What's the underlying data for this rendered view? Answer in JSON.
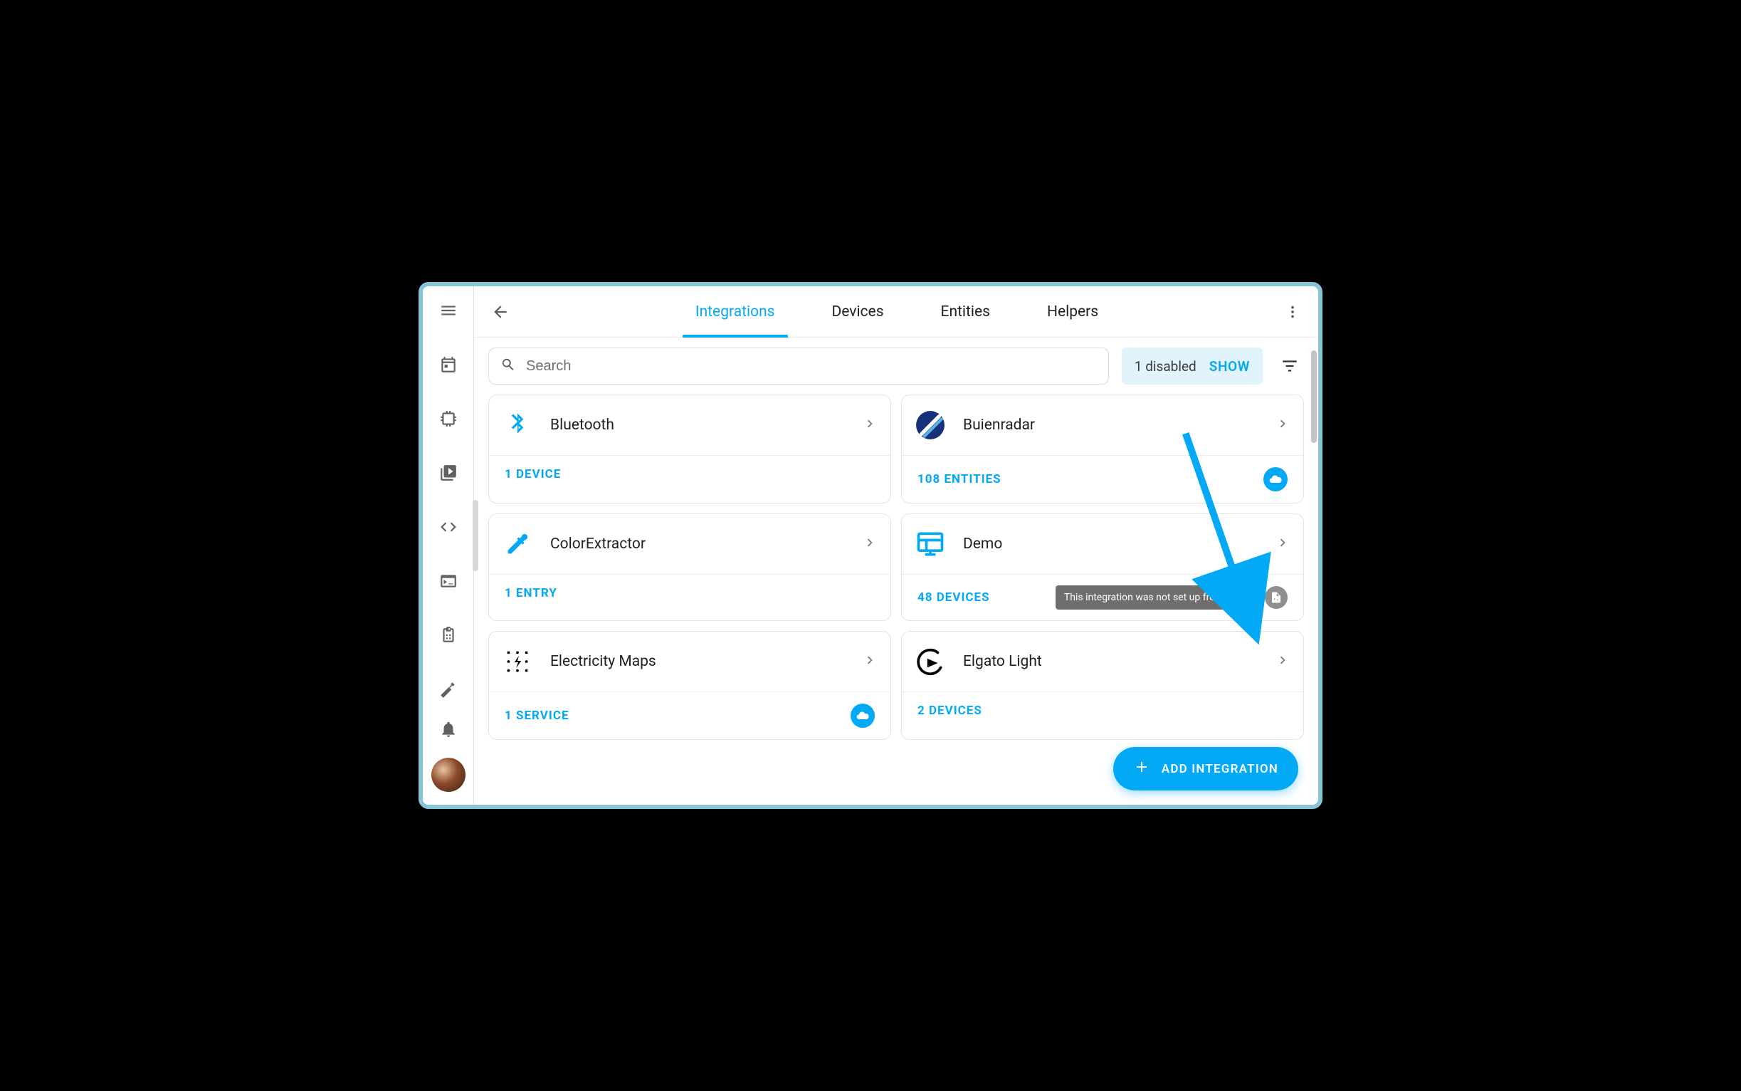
{
  "tabs": {
    "integrations": "Integrations",
    "devices": "Devices",
    "entities": "Entities",
    "helpers": "Helpers"
  },
  "search": {
    "placeholder": "Search"
  },
  "disabled_chip": {
    "count": "1 disabled",
    "show": "SHOW"
  },
  "tooltip": "This integration was not set up from the UI",
  "fab": "ADD INTEGRATION",
  "cards": {
    "bluetooth": {
      "title": "Bluetooth",
      "metric": "1 DEVICE"
    },
    "buienradar": {
      "title": "Buienradar",
      "metric": "108 ENTITIES"
    },
    "colorextractor": {
      "title": "ColorExtractor",
      "metric": "1 ENTRY"
    },
    "demo": {
      "title": "Demo",
      "metric": "48 DEVICES"
    },
    "electricitymaps": {
      "title": "Electricity Maps",
      "metric": "1 SERVICE"
    },
    "elgato": {
      "title": "Elgato Light",
      "metric": "2 DEVICES"
    }
  }
}
